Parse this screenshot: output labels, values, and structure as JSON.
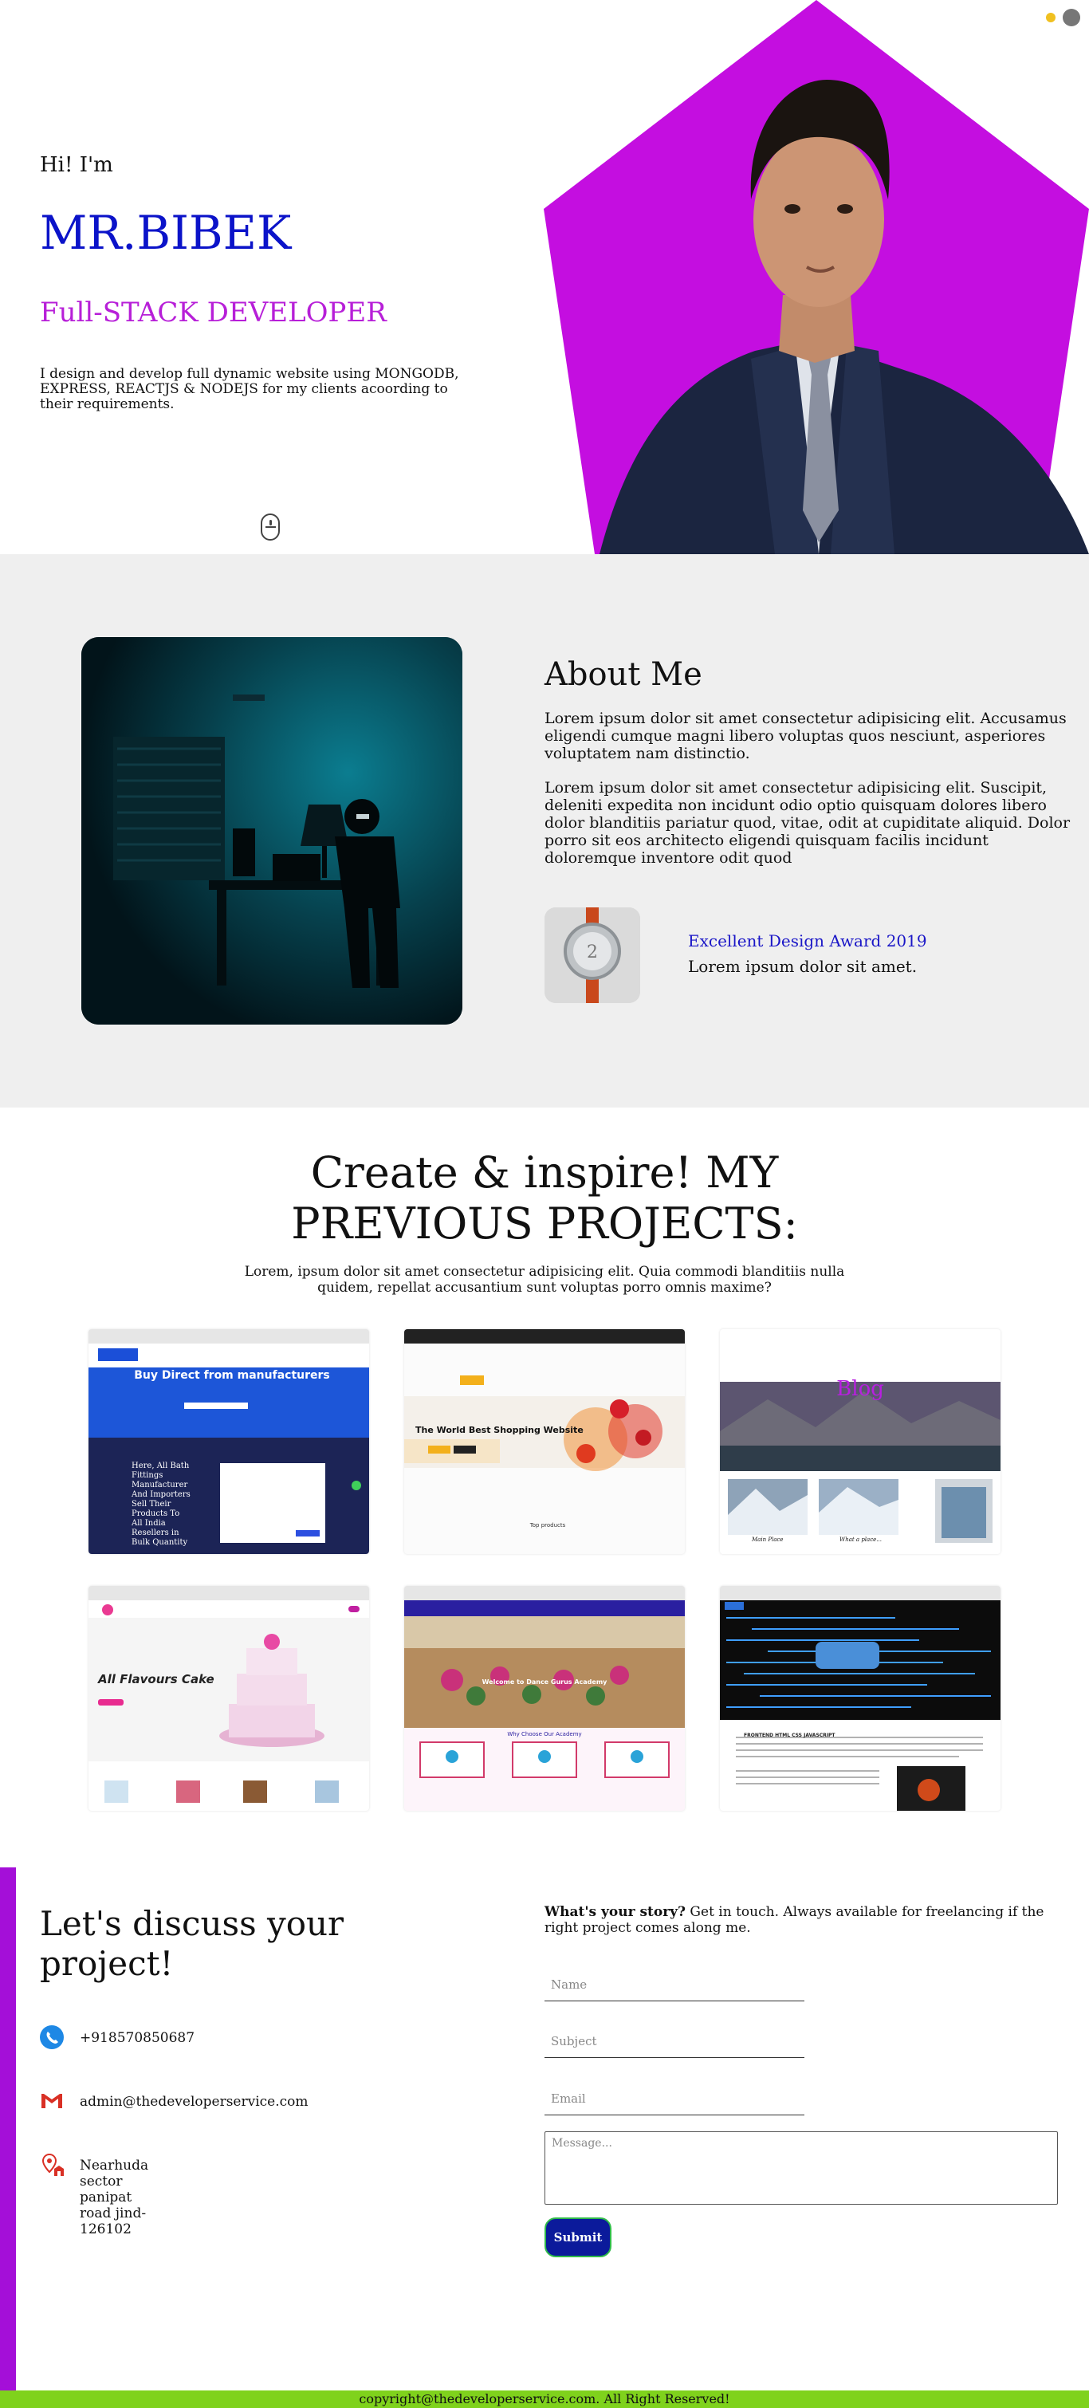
{
  "hero": {
    "greeting": "Hi! I'm",
    "name": "MR.BIBEK",
    "role": "Full-STACK DEVELOPER",
    "description": "I design and develop full dynamic website using MONGODB, EXPRESS, REACTJS & NODEJS for my clients acoording to their requirements.",
    "accent_color": "#c40ee0",
    "name_color": "#0b13c9"
  },
  "about": {
    "title": "About Me",
    "paragraph_1": "Lorem ipsum dolor sit amet consectetur adipisicing elit. Accusamus eligendi cumque magni libero voluptas quos nesciunt, asperiores voluptatem nam distinctio.",
    "paragraph_2": "Lorem ipsum dolor sit amet consectetur adipisicing elit. Suscipit, deleniti expedita non incidunt odio optio quisquam dolores libero dolor blanditiis pariatur quod, vitae, odit at cupiditate aliquid. Dolor porro sit eos architecto eligendi quisquam facilis incidunt doloremque inventore odit quod",
    "award_title": "Excellent Design Award 2019",
    "award_text": "Lorem ipsum dolor sit amet."
  },
  "projects": {
    "title_line_1": "Create & inspire! MY",
    "title_line_2": "PREVIOUS PROJECTS:",
    "description": "Lorem, ipsum dolor sit amet consectetur adipisicing elit. Quia commodi blanditiis nulla quidem, repellat accusantium sunt voluptas porro omnis maxime?",
    "items": [
      {
        "headline": "Buy Direct from manufacturers",
        "side_text": "Here, All Bath Fittings Manufacturer And Importers Sell Their Products To All India Resellers in Bulk Quantity"
      },
      {
        "headline": "The World Best Shopping Website",
        "sub": "Top products"
      },
      {
        "headline": "Blog",
        "captions": [
          "Main Place",
          "What a place..."
        ]
      },
      {
        "headline": "All Flavours Cake"
      },
      {
        "headline": "Welcome to Dance Gurus Academy",
        "sub": "Why Choose Our Academy"
      },
      {
        "headline": "FRONTEND HTML CSS JAVASCRIPT"
      }
    ]
  },
  "contact": {
    "title_line_1": "Let's discuss your",
    "title_line_2": "project!",
    "phone": "+918570850687",
    "email": "admin@thedeveloperservice.com",
    "address": "Nearhuda sector panipat road jind-126102",
    "story_bold": "What's your story?",
    "story_text": " Get in touch. Always available for freelancing if the right project comes along me.",
    "placeholders": {
      "name": "Name",
      "subject": "Subject",
      "email": "Email",
      "message": "Message..."
    },
    "submit_label": "Submit"
  },
  "footer": {
    "copyright": "copyright@thedeveloperservice.com. All Right Reserved!"
  },
  "icons": {
    "phone": "phone-icon",
    "email": "gmail-icon",
    "address": "location-pin-icon",
    "scroll": "mouse-scroll-icon",
    "theme": "theme-toggle-icon"
  }
}
